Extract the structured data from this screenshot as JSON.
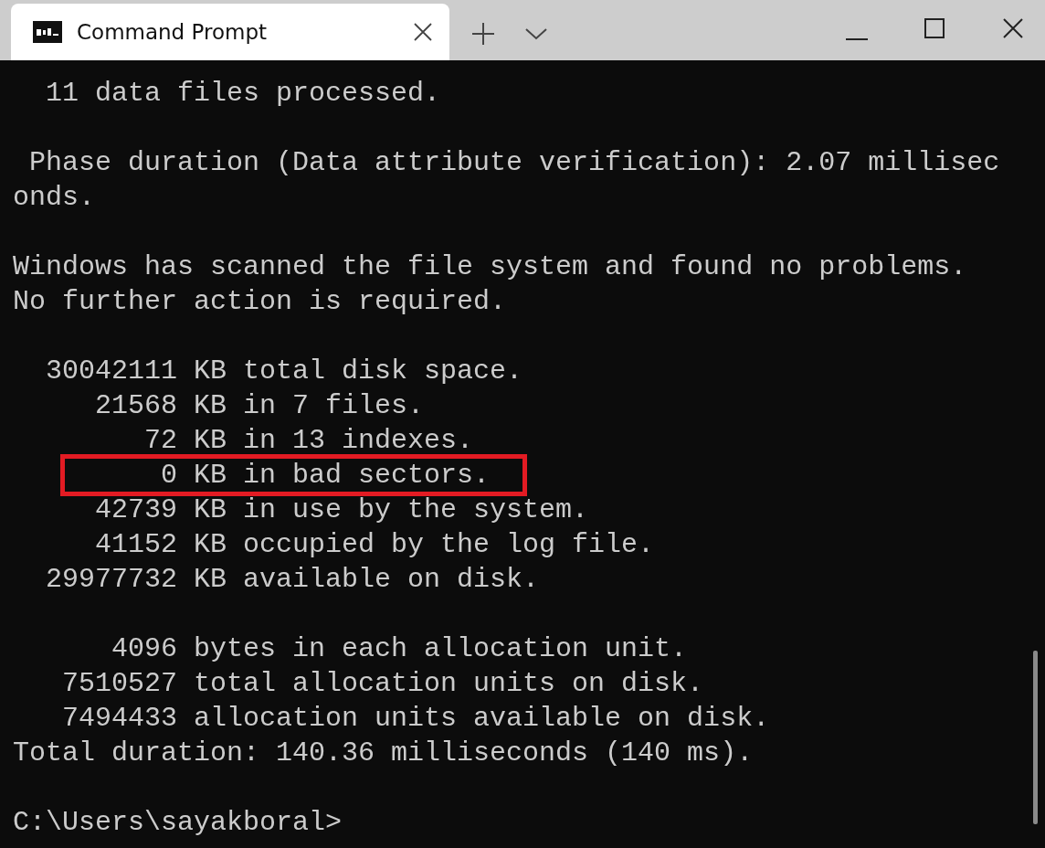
{
  "tabs": [
    {
      "label": "Command Prompt",
      "selected": true
    }
  ],
  "terminal": {
    "blocks": [
      {
        "lines": [
          {
            "text": "  11 data files processed."
          }
        ]
      },
      {
        "lines": [
          {
            "text": " Phase duration (Data attribute verification): 2.07 millisec"
          },
          {
            "text": "onds."
          }
        ]
      },
      {
        "lines": [
          {
            "text": "Windows has scanned the file system and found no problems."
          },
          {
            "text": "No further action is required."
          }
        ]
      },
      {
        "lines": [
          {
            "text": "  30042111 KB total disk space."
          },
          {
            "text": "     21568 KB in 7 files."
          },
          {
            "text": "        72 KB in 13 indexes."
          },
          {
            "text": "         0 KB in bad sectors.",
            "highlighted": true
          },
          {
            "text": "     42739 KB in use by the system."
          },
          {
            "text": "     41152 KB occupied by the log file."
          },
          {
            "text": "  29977732 KB available on disk."
          }
        ]
      },
      {
        "lines": [
          {
            "text": "      4096 bytes in each allocation unit."
          },
          {
            "text": "   7510527 total allocation units on disk."
          },
          {
            "text": "   7494433 allocation units available on disk."
          },
          {
            "text": "Total duration: 140.36 milliseconds (140 ms)."
          }
        ]
      },
      {
        "lines": [
          {
            "text": "C:\\Users\\sayakboral>"
          }
        ]
      }
    ]
  }
}
